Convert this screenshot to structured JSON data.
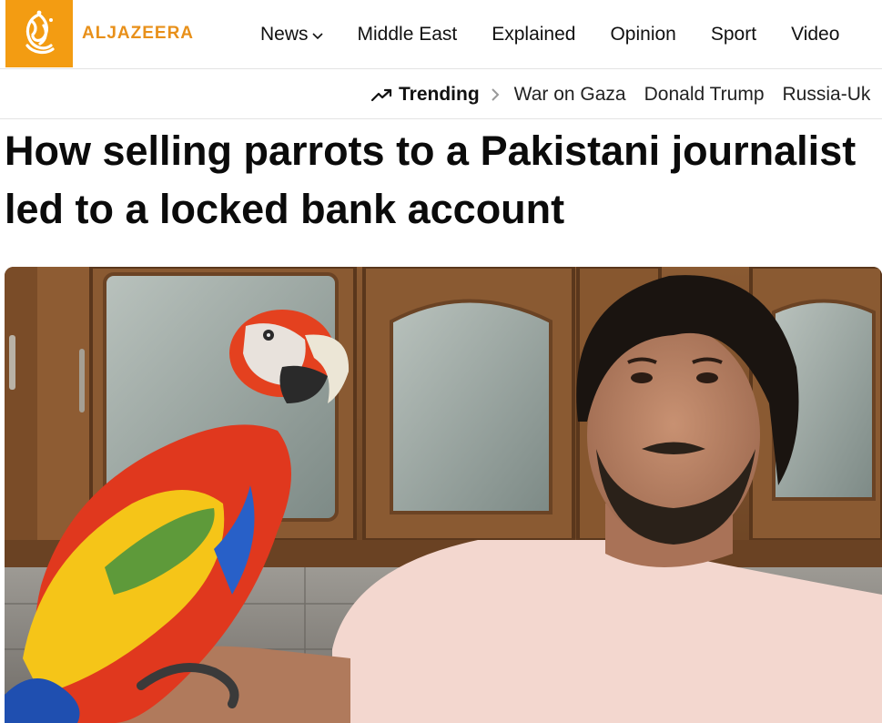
{
  "brand": {
    "wordmark": "ALJAZEERA",
    "color": "#f39c12"
  },
  "nav": {
    "items": [
      {
        "label": "News",
        "has_dropdown": true
      },
      {
        "label": "Middle East"
      },
      {
        "label": "Explained"
      },
      {
        "label": "Opinion"
      },
      {
        "label": "Sport"
      },
      {
        "label": "Video"
      }
    ]
  },
  "trending": {
    "label": "Trending",
    "icon": "trending-up-icon",
    "topics": [
      "War on Gaza",
      "Donald Trump",
      "Russia-Uk"
    ]
  },
  "article": {
    "headline": "How selling parrots to a Pakistani journalist led to a locked bank account"
  },
  "hero_image": {
    "subject": "photo-of-man-with-scarlet-macaw-parrot"
  }
}
